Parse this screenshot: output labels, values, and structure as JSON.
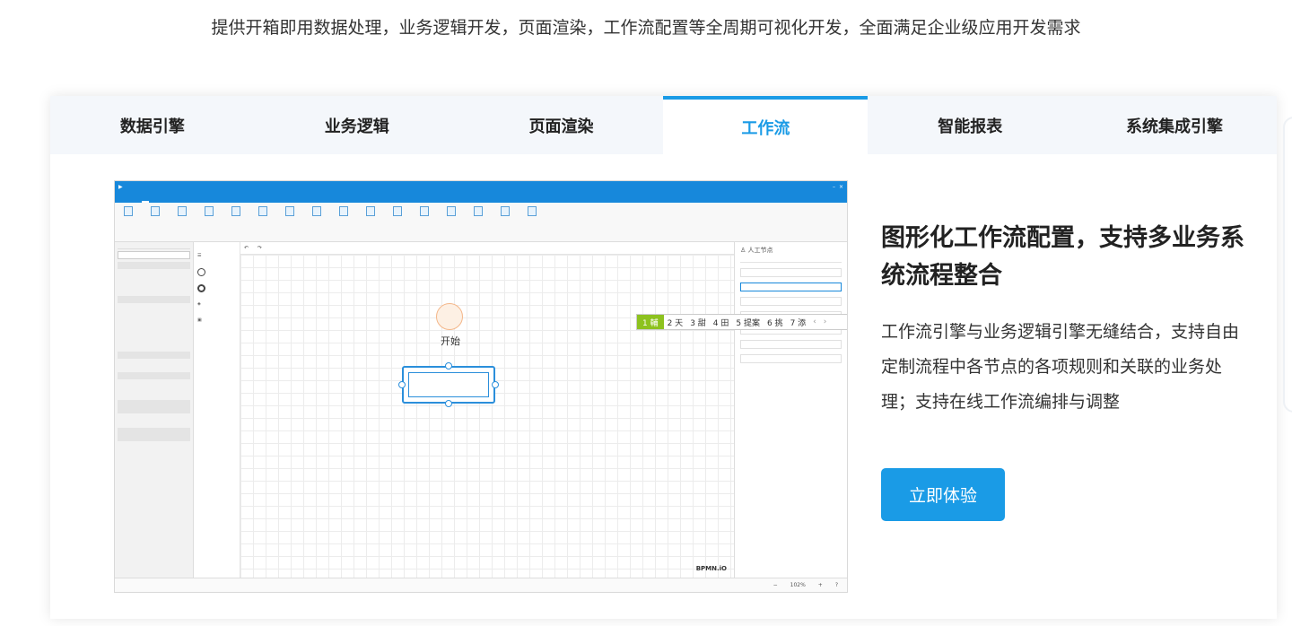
{
  "subtitle": "提供开箱即用数据处理，业务逻辑开发，页面渲染，工作流配置等全周期可视化开发，全面满足企业级应用开发需求",
  "tabs": [
    {
      "label": "数据引擎",
      "active": false
    },
    {
      "label": "业务逻辑",
      "active": false
    },
    {
      "label": "页面渲染",
      "active": false
    },
    {
      "label": "工作流",
      "active": true
    },
    {
      "label": "智能报表",
      "active": false
    },
    {
      "label": "系统集成引擎",
      "active": false
    }
  ],
  "feature": {
    "title": "图形化工作流配置，支持多业务系统流程整合",
    "description": "工作流引擎与业务逻辑引擎无缝结合，支持自由定制流程中各节点的各项规则和关联的业务处理；支持在线工作流编排与调整",
    "cta_label": "立即体验"
  },
  "screenshot": {
    "start_label": "开始",
    "brand_mark": "BPMN.iO",
    "node_title": "人工节点",
    "ime_candidates": [
      "1 輔",
      "2 天",
      "3 甜",
      "4 田",
      "5 提案",
      "6 挑",
      "7 添"
    ],
    "zoom": "102%"
  },
  "colors": {
    "accent": "#1a9be6",
    "tab_bg": "#f4f7fb",
    "ime_highlight": "#8dc21f"
  }
}
